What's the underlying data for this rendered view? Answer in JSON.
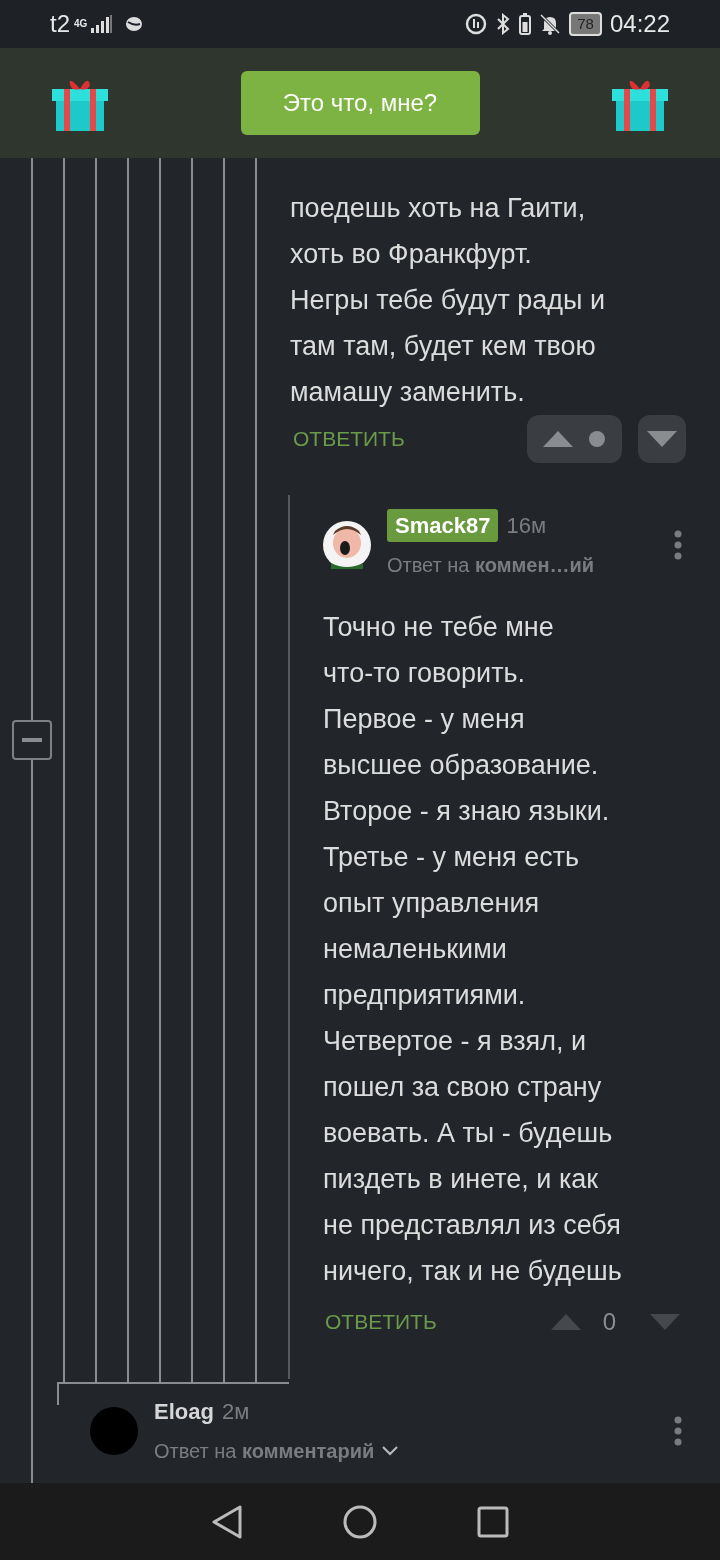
{
  "status_bar": {
    "carrier": "t2",
    "network": "4G",
    "battery": "78",
    "time": "04:22"
  },
  "promo": {
    "button": "Это что, мне?"
  },
  "comments": [
    {
      "kind": "continued",
      "body": "поедешь хоть на Гаити,\nхоть во Франкфурт.\nНегры тебе будут рады и\nтам там, будет кем твою\nмамашу заменить.",
      "reply": "ОТВЕТИТЬ",
      "score_hidden": true
    },
    {
      "kind": "reply",
      "author": "Smack87",
      "highlighted": true,
      "time": "16м",
      "reply_prefix": "Ответ на",
      "reply_target": "коммен…ий",
      "body": "Точно не тебе мне\nчто-то говорить.\nПервое - у меня\nвысшее образование.\nВторое - я знаю языки.\nТретье - у меня есть\nопыт управления\nнемаленькими\nпредприятиями.\nЧетвертое - я взял, и\nпошел за свою страну\nвоевать. А ты - будешь\nпиздеть в инете, и как\nне представлял из себя\nничего, так и не будешь",
      "reply": "ОТВЕТИТЬ",
      "score_hidden": false,
      "score": "0"
    },
    {
      "kind": "header",
      "author": "Eloag",
      "highlighted": false,
      "avatar": {
        "kind": "plain"
      },
      "time": "2м",
      "reply_prefix": "Ответ на",
      "reply_target": "комментарий",
      "expandable": true
    }
  ]
}
